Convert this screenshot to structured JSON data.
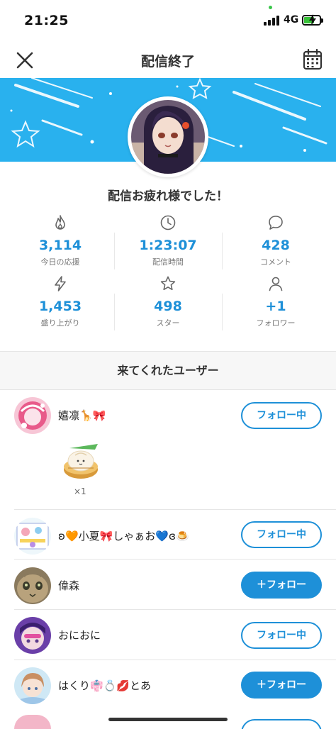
{
  "status_bar": {
    "time": "21:25",
    "network": "4G"
  },
  "nav": {
    "title": "配信終了",
    "close_icon": "close-icon",
    "calendar_icon": "calendar-icon"
  },
  "colors": {
    "accent": "#1e90d8",
    "banner": "#29b1ee"
  },
  "message": "配信お疲れ様でした！",
  "stats": [
    {
      "icon": "flame-icon",
      "value": "3,114",
      "label": "今日の応援"
    },
    {
      "icon": "clock-icon",
      "value": "1:23:07",
      "label": "配信時間"
    },
    {
      "icon": "comment-icon",
      "value": "428",
      "label": "コメント"
    },
    {
      "icon": "lightning-icon",
      "value": "1,453",
      "label": "盛り上がり"
    },
    {
      "icon": "star-icon",
      "value": "498",
      "label": "スター"
    },
    {
      "icon": "person-icon",
      "value": "+1",
      "label": "フォロワー"
    }
  ],
  "visitors": {
    "heading": "来てくれたユーザー",
    "users": [
      {
        "name": "嬉凛🦒🎀",
        "button": "フォロー中",
        "state": "following"
      },
      {
        "name": "ʚ🧡小夏🎀しゃぁお💙ɞ🍮",
        "button": "フォロー中",
        "state": "following"
      },
      {
        "name": "偉森",
        "button": "＋フォロー",
        "state": "follow"
      },
      {
        "name": "おにおに",
        "button": "フォロー中",
        "state": "following"
      },
      {
        "name": "はくり👘💍💋とあ",
        "button": "＋フォロー",
        "state": "follow"
      }
    ],
    "gift": {
      "icon": "dumpling-gift-icon",
      "count": "×1"
    }
  }
}
